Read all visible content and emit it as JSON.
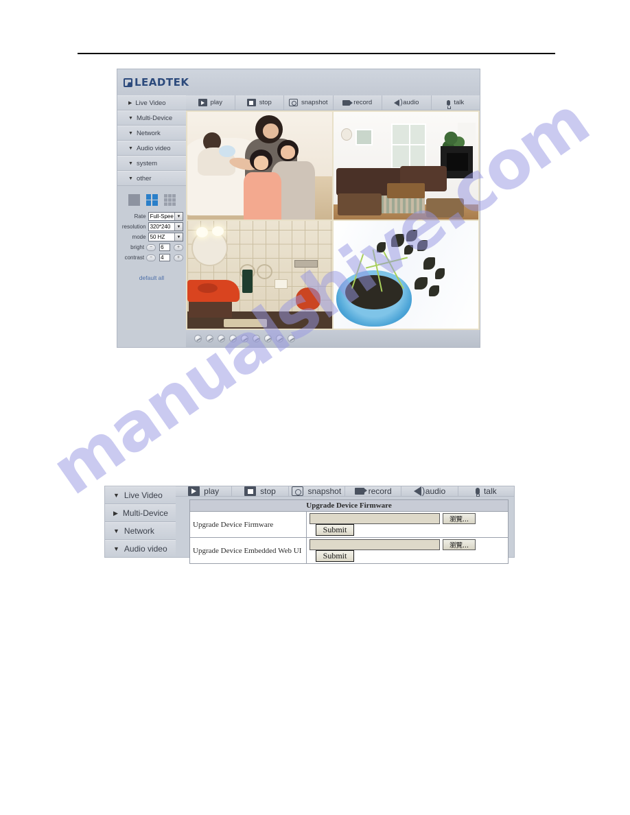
{
  "document": {
    "watermark": "manualshive.com"
  },
  "top_app": {
    "brand": "LEADTEK",
    "sidebar": [
      {
        "label": "Live Video",
        "arrow": "▶"
      },
      {
        "label": "Multi-Device",
        "arrow": "▼"
      },
      {
        "label": "Network",
        "arrow": "▼"
      },
      {
        "label": "Audio video",
        "arrow": "▼"
      },
      {
        "label": "system",
        "arrow": "▼"
      },
      {
        "label": "other",
        "arrow": "▼"
      }
    ],
    "toolbar": [
      {
        "label": "play",
        "icon": "play-icon"
      },
      {
        "label": "stop",
        "icon": "stop-icon"
      },
      {
        "label": "snapshot",
        "icon": "snapshot-icon"
      },
      {
        "label": "record",
        "icon": "record-icon"
      },
      {
        "label": "audio",
        "icon": "audio-icon"
      },
      {
        "label": "talk",
        "icon": "talk-icon"
      }
    ],
    "view_modes": [
      {
        "name": "single-view",
        "active": false
      },
      {
        "name": "quad-view",
        "active": true
      },
      {
        "name": "nine-view",
        "active": false
      }
    ],
    "controls": {
      "rate_label": "Rate",
      "rate_value": "Full-Spee",
      "resolution_label": "resolution",
      "resolution_value": "320*240",
      "mode_label": "mode",
      "mode_value": "50 HZ",
      "bright_label": "bright",
      "bright_value": "6",
      "contrast_label": "contrast",
      "contrast_value": "4",
      "minus": "−",
      "plus": "+",
      "default_all": "default all"
    },
    "video_cells": [
      {
        "name": "camera-cell-family",
        "caption": "family and baby bedroom scene"
      },
      {
        "name": "camera-cell-living",
        "caption": "living room with sofa and fireplace"
      },
      {
        "name": "camera-cell-bath",
        "caption": "bathroom with orange sink"
      },
      {
        "name": "camera-cell-plant",
        "caption": "seedlings in blue bowl"
      }
    ],
    "ptz_button_count": 9
  },
  "bottom_app": {
    "sidebar": [
      {
        "label": "Live Video",
        "arrow": "▼"
      },
      {
        "label": "Multi-Device",
        "arrow": "▶"
      },
      {
        "label": "Network",
        "arrow": "▼"
      },
      {
        "label": "Audio video",
        "arrow": "▼"
      }
    ],
    "toolbar": [
      {
        "label": "play",
        "icon": "play-icon"
      },
      {
        "label": "stop",
        "icon": "stop-icon"
      },
      {
        "label": "snapshot",
        "icon": "snapshot-icon"
      },
      {
        "label": "record",
        "icon": "record-icon"
      },
      {
        "label": "audio",
        "icon": "audio-icon"
      },
      {
        "label": "talk",
        "icon": "talk-icon"
      }
    ],
    "firmware": {
      "title": "Upgrade Device Firmware",
      "rows": [
        {
          "label": "Upgrade Device Firmware",
          "value": "",
          "browse": "瀏覽...",
          "submit": "Submit"
        },
        {
          "label": "Upgrade Device Embedded Web UI",
          "value": "",
          "browse": "瀏覽...",
          "submit": "Submit"
        }
      ]
    }
  },
  "colors": {
    "chrome": "#c7cdd6",
    "brand_blue": "#2c4a7c",
    "accent_blue": "#2a7fc9",
    "link_blue": "#4d6fa8",
    "watermark": "#9696e1"
  }
}
